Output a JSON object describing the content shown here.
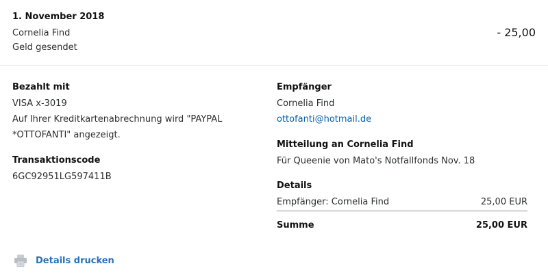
{
  "header": {
    "date": "1. November 2018",
    "name": "Cornelia Find",
    "subtitle": "Geld gesendet",
    "amount": "- 25,00"
  },
  "paid_with": {
    "label": "Bezahlt mit",
    "card": "VISA x-3019",
    "note_line1": "Auf Ihrer Kreditkartenabrechnung wird \"PAYPAL",
    "note_line2": "*OTTOFANTI\" angezeigt."
  },
  "transaction": {
    "label": "Transaktionscode",
    "code": "6GC92951LG597411B"
  },
  "recipient": {
    "label": "Empfänger",
    "name": "Cornelia Find",
    "email": "ottofanti@hotmail.de"
  },
  "message": {
    "label": "Mitteilung an Cornelia Find",
    "text": "Für Queenie von Mato's Notfallfonds Nov. 18"
  },
  "details": {
    "label": "Details",
    "row_label": "Empfänger: Cornelia Find",
    "row_value": "25,00 EUR",
    "total_label": "Summe",
    "total_value": "25,00 EUR"
  },
  "print": {
    "label": "Details drucken",
    "icon": "printer-icon"
  },
  "colors": {
    "link": "#0a5fa8",
    "print_link": "#2a71b6",
    "divider": "#e9ebed"
  }
}
